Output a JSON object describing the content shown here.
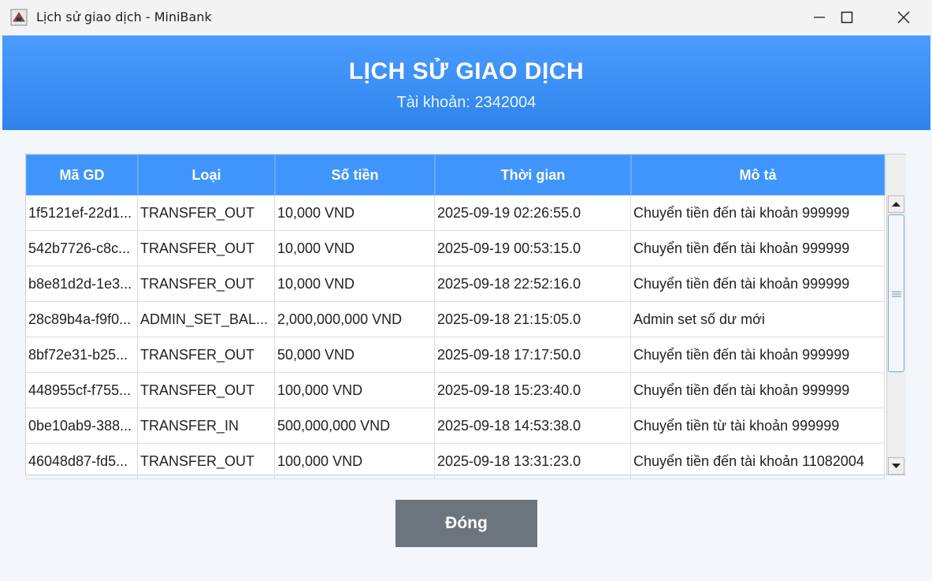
{
  "window": {
    "title": "Lịch sử giao dịch - MiniBank"
  },
  "header": {
    "title": "LỊCH SỬ GIAO DỊCH",
    "subtitle": "Tài khoản: 2342004"
  },
  "table": {
    "columns": [
      "Mã GD",
      "Loại",
      "Số tiền",
      "Thời gian",
      "Mô tả"
    ],
    "rows": [
      [
        "1f5121ef-22d1...",
        "TRANSFER_OUT",
        "10,000 VND",
        "2025-09-19 02:26:55.0",
        "Chuyển tiền đến tài khoản 999999"
      ],
      [
        "542b7726-c8c...",
        "TRANSFER_OUT",
        "10,000 VND",
        "2025-09-19 00:53:15.0",
        "Chuyển tiền đến tài khoản 999999"
      ],
      [
        "b8e81d2d-1e3...",
        "TRANSFER_OUT",
        "10,000 VND",
        "2025-09-18 22:52:16.0",
        "Chuyển tiền đến tài khoản 999999"
      ],
      [
        "28c89b4a-f9f0...",
        "ADMIN_SET_BAL...",
        "2,000,000,000 VND",
        "2025-09-18 21:15:05.0",
        "Admin set số dư mới"
      ],
      [
        "8bf72e31-b25...",
        "TRANSFER_OUT",
        "50,000 VND",
        "2025-09-18 17:17:50.0",
        "Chuyển tiền đến tài khoản 999999"
      ],
      [
        "448955cf-f755...",
        "TRANSFER_OUT",
        "100,000 VND",
        "2025-09-18 15:23:40.0",
        "Chuyển tiền đến tài khoản 999999"
      ],
      [
        "0be10ab9-388...",
        "TRANSFER_IN",
        "500,000,000 VND",
        "2025-09-18 14:53:38.0",
        "Chuyển tiền từ tài khoản 999999"
      ],
      [
        "46048d87-fd5...",
        "TRANSFER_OUT",
        "100,000 VND",
        "2025-09-18 13:31:23.0",
        "Chuyển tiền đến tài khoản 11082004"
      ]
    ]
  },
  "footer": {
    "close_label": "Đóng"
  },
  "colors": {
    "header_blue": "#3f95fb",
    "button_gray": "#6c757d"
  }
}
